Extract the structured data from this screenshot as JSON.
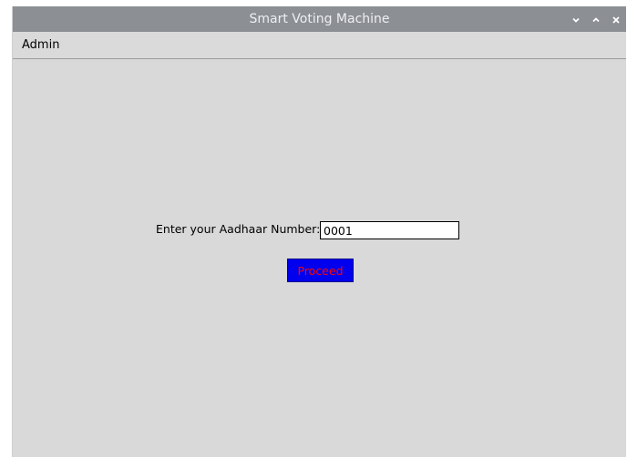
{
  "window": {
    "title": "Smart Voting Machine",
    "controls": [
      {
        "name": "minimize",
        "icon": "chevron-down-icon"
      },
      {
        "name": "maximize",
        "icon": "chevron-up-icon"
      },
      {
        "name": "close",
        "icon": "close-icon"
      }
    ]
  },
  "menubar": {
    "items": [
      {
        "label": "Admin"
      }
    ]
  },
  "form": {
    "aadhaar_label": "Enter your Aadhaar Number:",
    "aadhaar_value": "0001",
    "proceed_label": "Proceed"
  },
  "colors": {
    "titlebar": "#8c8f93",
    "window_bg": "#d9d9d9",
    "proceed_bg": "#0000ee",
    "proceed_text": "#ff0000"
  }
}
